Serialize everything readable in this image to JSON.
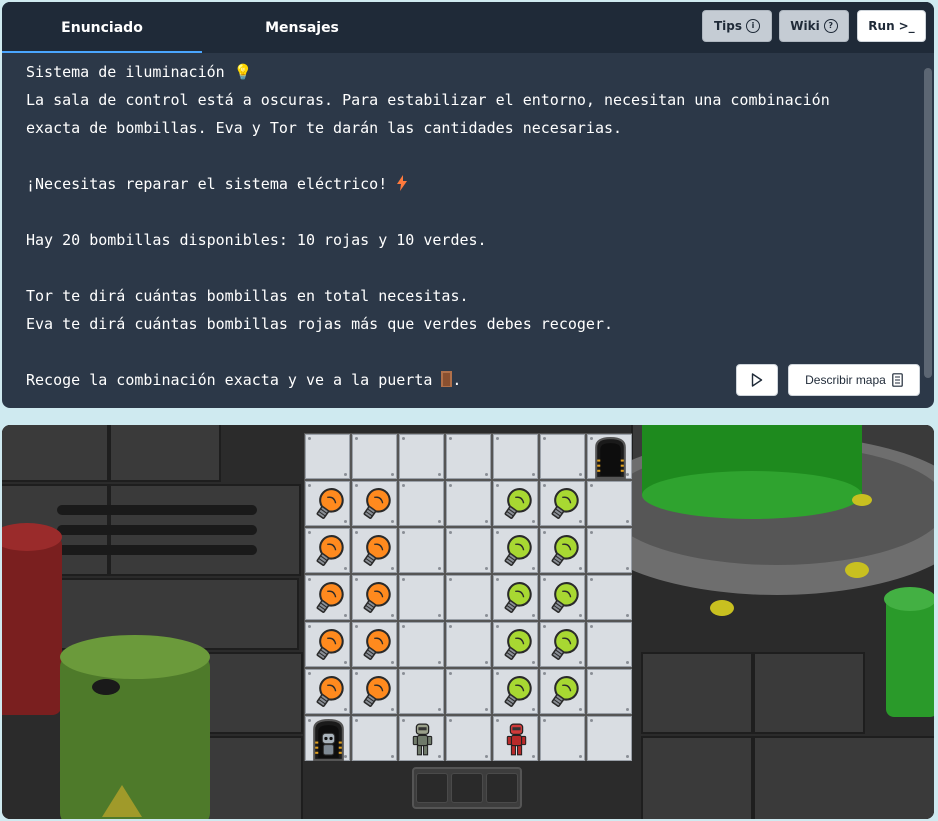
{
  "tabs": [
    {
      "label": "Enunciado",
      "active": true
    },
    {
      "label": "Mensajes",
      "active": false
    }
  ],
  "toolbar": {
    "tips_label": "Tips",
    "wiki_label": "Wiki",
    "run_label": "Run",
    "run_icon": ">_",
    "tips_icon": "info-circle-icon",
    "wiki_icon": "question-circle-icon"
  },
  "statement": {
    "title": "Sistema de iluminación",
    "title_icon": "💡",
    "line_1": "La sala de control está a oscuras. Para estabilizar el entorno, necesitan una combinación",
    "line_2": "exacta de bombillas. Eva y Tor te darán las cantidades necesarias.",
    "line_3": "¡Necesitas reparar el sistema eléctrico!",
    "line_3_icon": "lightning-icon",
    "line_4": "Hay 20 bombillas disponibles: 10 rojas y 10 verdes.",
    "line_5": "Tor te dirá cuántas bombillas en total necesitas.",
    "line_6": "Eva te dirá cuántas bombillas rojas más que verdes debes recoger.",
    "line_7": "Recoge la combinación exacta y ve a la puerta",
    "line_7_icon": "door-icon",
    "line_7_end": "."
  },
  "actions": {
    "describe_map_label": "Describir mapa",
    "play_icon": "play-icon",
    "describe_map_icon": "document-icon"
  },
  "board": {
    "rows": 7,
    "cols": 7,
    "cells": [
      [
        "tile",
        "tile",
        "tile",
        "tile",
        "tile",
        "tile",
        "exit-door"
      ],
      [
        "orange-bulb",
        "orange-bulb",
        "tile",
        "tile",
        "green-bulb",
        "green-bulb",
        "tile"
      ],
      [
        "orange-bulb",
        "orange-bulb",
        "tile",
        "tile",
        "green-bulb",
        "green-bulb",
        "tile"
      ],
      [
        "orange-bulb",
        "orange-bulb",
        "tile",
        "tile",
        "green-bulb",
        "green-bulb",
        "tile"
      ],
      [
        "orange-bulb",
        "orange-bulb",
        "tile",
        "tile",
        "green-bulb",
        "green-bulb",
        "tile"
      ],
      [
        "orange-bulb",
        "orange-bulb",
        "tile",
        "tile",
        "green-bulb",
        "green-bulb",
        "tile"
      ],
      [
        "start-door-robot",
        "tile",
        "robot-tor",
        "tile",
        "robot-eva",
        "tile",
        "tile"
      ]
    ]
  },
  "inventory": {
    "slots": 3
  },
  "colors": {
    "panel_bg": "#2c3848",
    "tabbar_bg": "#1f2a38",
    "accent": "#4aa6ff",
    "orange_bulb": "#ff8a1e",
    "green_bulb": "#a8d832",
    "page_bg": "#cfeaf0"
  }
}
